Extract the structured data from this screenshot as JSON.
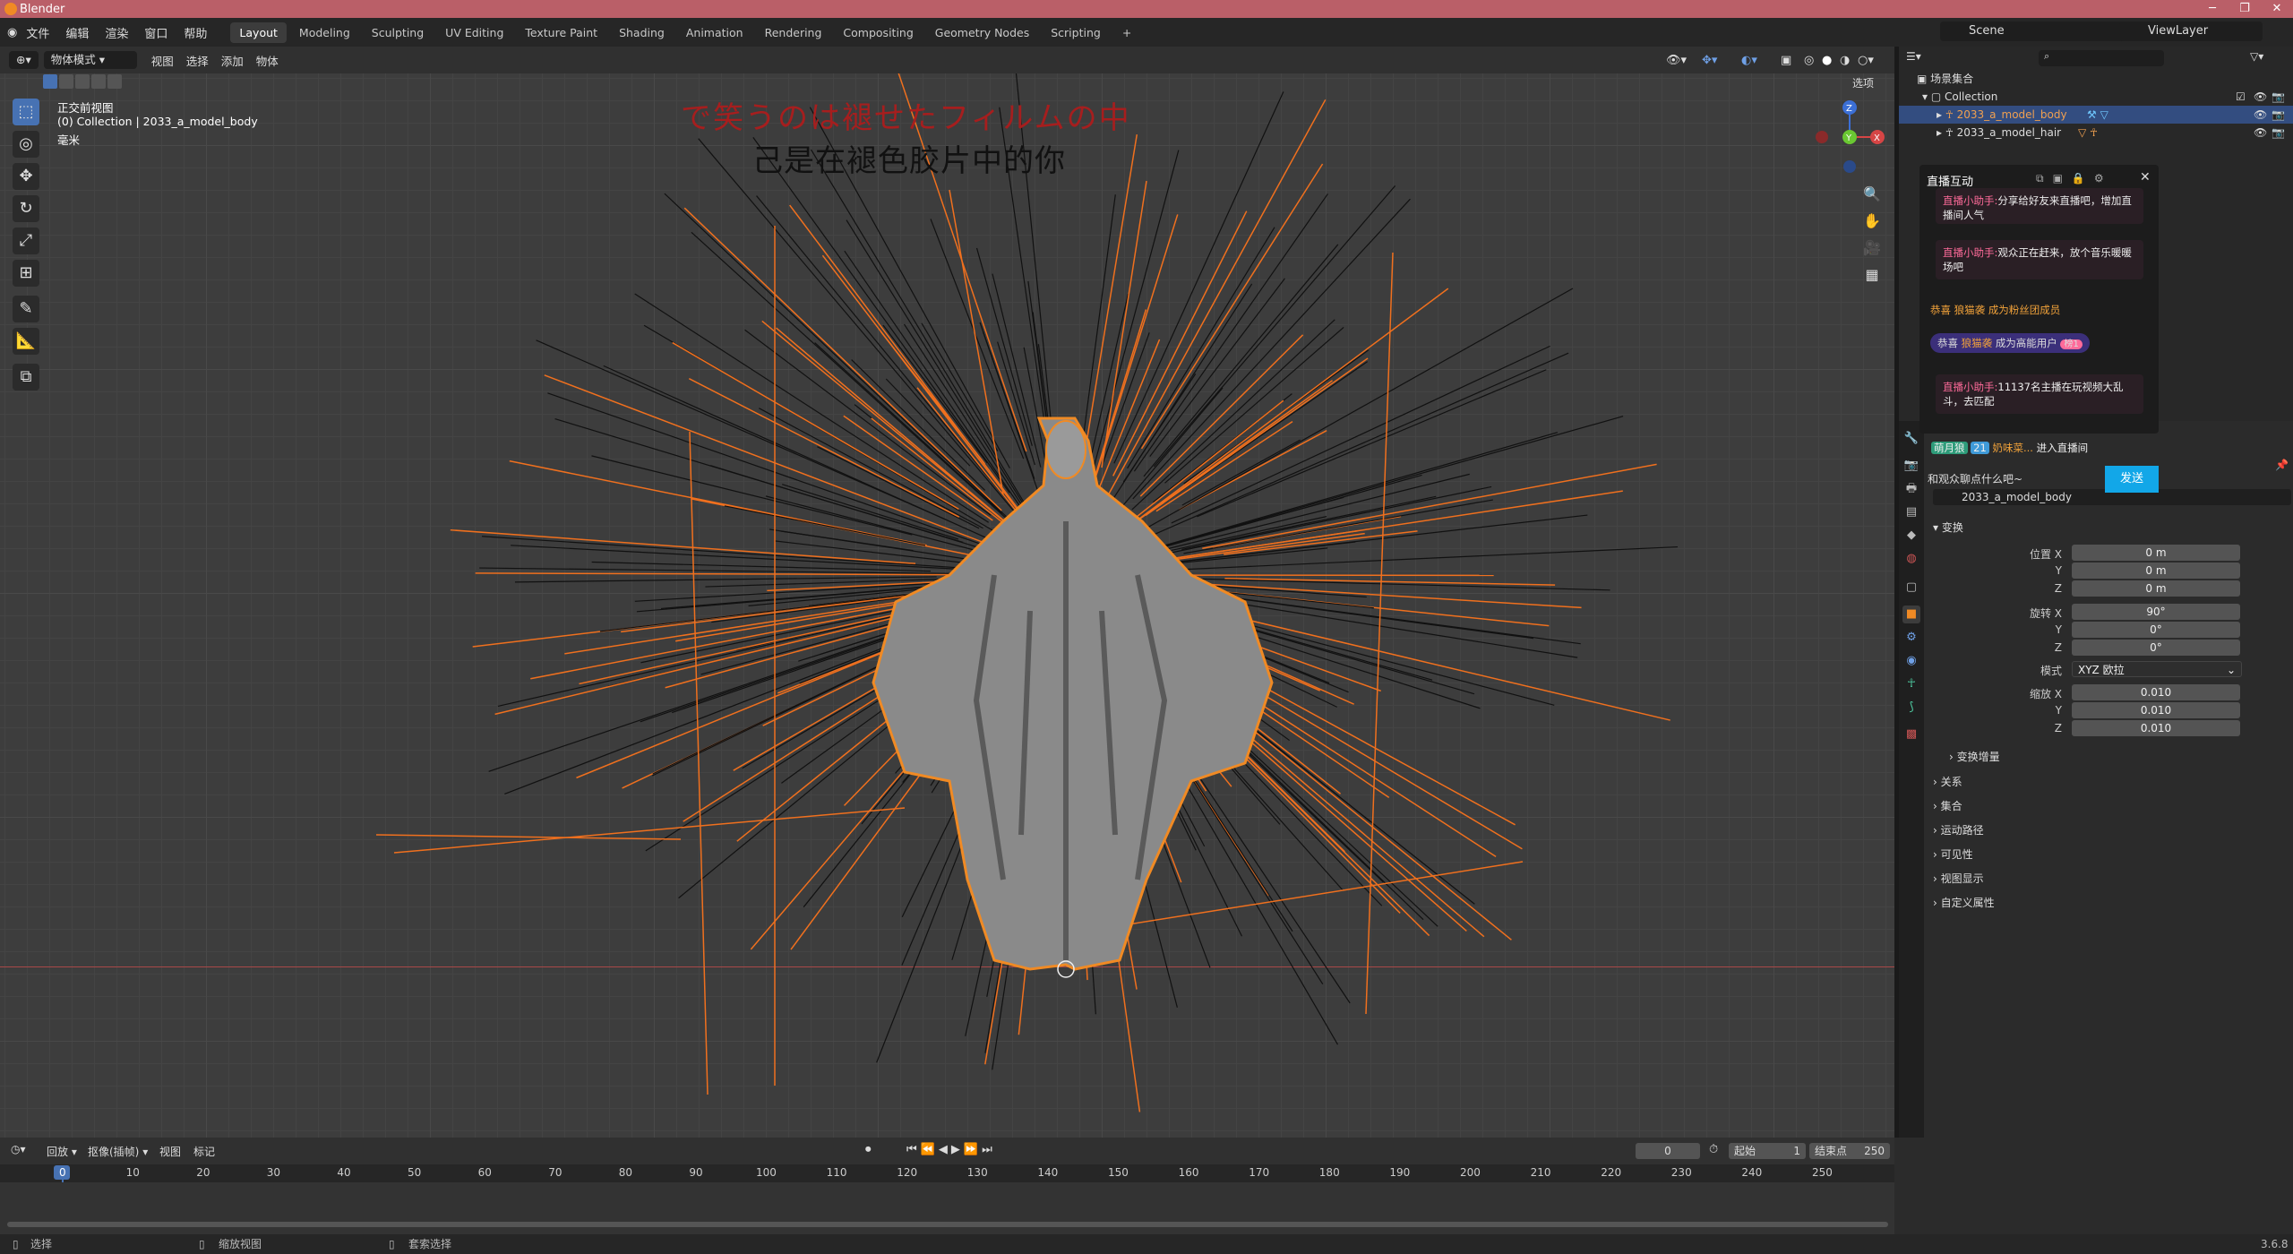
{
  "window": {
    "title": "Blender",
    "version": "3.6.8"
  },
  "menu": {
    "items": [
      "文件",
      "编辑",
      "渲染",
      "窗口",
      "帮助"
    ]
  },
  "workspaces": {
    "tabs": [
      "Layout",
      "Modeling",
      "Sculpting",
      "UV Editing",
      "Texture Paint",
      "Shading",
      "Animation",
      "Rendering",
      "Compositing",
      "Geometry Nodes",
      "Scripting"
    ],
    "active": "Layout",
    "add": "+"
  },
  "scene": {
    "name": "Scene",
    "view_layer": "ViewLayer"
  },
  "viewport": {
    "mode": "物体模式",
    "header_menus": [
      "视图",
      "选择",
      "添加",
      "物体"
    ],
    "view_name": "正交前视图",
    "collection_line": "(0) Collection | 2033_a_model_body",
    "units": "毫米",
    "options_label": "选项",
    "gizmo": {
      "x": "X",
      "y": "Y",
      "z": "Z"
    }
  },
  "lyrics": {
    "line1": "で笑うのは褪せたフィルムの中",
    "line2": "己是在褪色胶片中的你"
  },
  "outliner": {
    "root": "场景集合",
    "collection": "Collection",
    "objects": [
      {
        "name": "2033_a_model_body",
        "selected": true
      },
      {
        "name": "2033_a_model_hair",
        "selected": false
      }
    ]
  },
  "live": {
    "title": "直播互动",
    "messages": [
      {
        "prefix": "直播小助手:",
        "text": "分享给好友来直播吧，增加直播间人气"
      },
      {
        "prefix": "直播小助手:",
        "text": "观众正在赶来，放个音乐暖暖场吧"
      },
      {
        "prefix": "恭喜",
        "user": "狼猫袭",
        "text": "成为粉丝团成员"
      },
      {
        "prefix": "恭喜",
        "user": "狼猫袭",
        "text": "成为高能用户",
        "badge": "榜1"
      },
      {
        "prefix": "直播小助手:",
        "text": "11137名主播在玩视频大乱斗，去匹配"
      }
    ],
    "enter": {
      "badge": "萌月狼",
      "level": "21",
      "user": "奶味菜...",
      "text": "进入直播间"
    },
    "input_placeholder": "和观众聊点什么吧~",
    "send": "发送"
  },
  "properties": {
    "object_name": "2033_a_model_body",
    "section_transform": "变换",
    "location_label": "位置 X",
    "loc": {
      "x": "0 m",
      "y": "0 m",
      "z": "0 m"
    },
    "rotation_label": "旋转 X",
    "rot": {
      "x": "90°",
      "y": "0°",
      "z": "0°"
    },
    "mode_label": "模式",
    "mode_value": "XYZ 欧拉",
    "scale_label": "缩放 X",
    "scale": {
      "x": "0.010",
      "y": "0.010",
      "z": "0.010"
    },
    "axis_y": "Y",
    "axis_z": "Z",
    "sub_delta": "变换增量",
    "sections": [
      "关系",
      "集合",
      "运动路径",
      "可见性",
      "视图显示",
      "自定义属性"
    ]
  },
  "timeline": {
    "menus": [
      "回放",
      "抠像(插帧)",
      "视图",
      "标记"
    ],
    "current_frame": "0",
    "start_label": "起始",
    "start": "1",
    "end_label": "结束点",
    "end": "250",
    "ticks": [
      "0",
      "10",
      "20",
      "30",
      "40",
      "50",
      "60",
      "70",
      "80",
      "90",
      "100",
      "110",
      "120",
      "130",
      "140",
      "150",
      "160",
      "170",
      "180",
      "190",
      "200",
      "210",
      "220",
      "230",
      "240",
      "250"
    ]
  },
  "status": {
    "select": "选择",
    "zoom": "缩放视图",
    "lasso": "套索选择"
  },
  "colors": {
    "accent": "#4772b3",
    "title": "#ba5f68",
    "selection": "#f08a24",
    "send": "#12a7e8"
  }
}
